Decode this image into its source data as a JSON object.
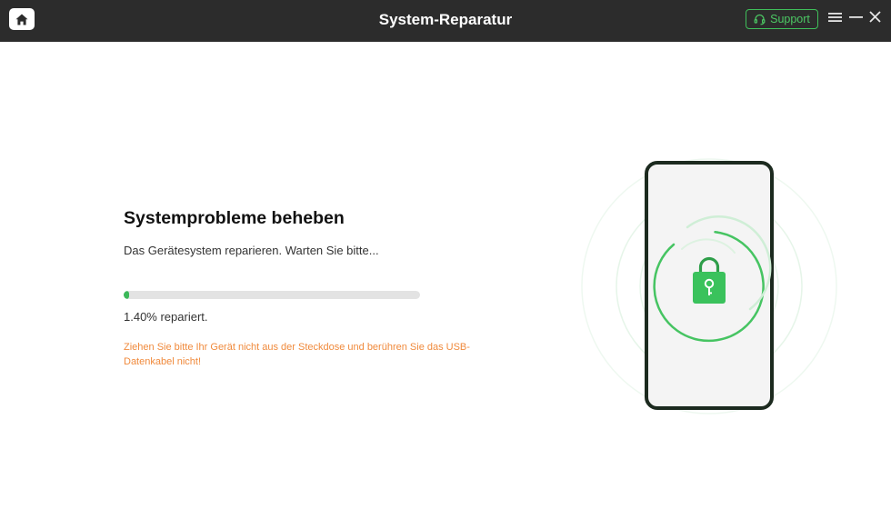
{
  "window": {
    "title": "System-Reparatur",
    "support_label": "Support"
  },
  "icons": {
    "home": "home-icon",
    "support": "headset-icon",
    "menu": "menu-icon",
    "minimize": "minimize-icon",
    "close": "close-icon",
    "lock": "lock-icon"
  },
  "main": {
    "heading": "Systemprobleme beheben",
    "subtext": "Das Gerätesystem reparieren. Warten Sie bitte...",
    "progress_percent": 1.4,
    "progress_text": "1.40% repariert.",
    "warning": "Ziehen Sie bitte Ihr Gerät nicht aus der Steckdose und berühren Sie das USB-Datenkabel nicht!"
  },
  "colors": {
    "accent": "#3cb85a",
    "titlebar": "#2c2c2c",
    "warning": "#f08a3c",
    "phone_frame": "#1c2a1f"
  }
}
